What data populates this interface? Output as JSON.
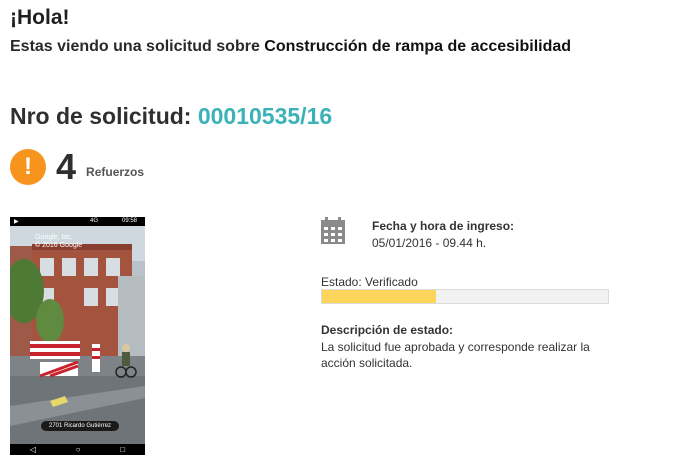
{
  "greeting": "¡Hola!",
  "intro": {
    "prefix": "Estas viendo una solicitud sobre",
    "subject": "Construcción de rampa de accesibilidad"
  },
  "request": {
    "label": "Nro de solicitud:",
    "number": "00010535/16"
  },
  "support": {
    "icon": "exclamation-icon",
    "count": "4",
    "label": "Refuerzos"
  },
  "photo": {
    "status_time": "09:58",
    "status_signal": "4G",
    "watermark_line1": "Google, Inc.",
    "watermark_line2": "© 2016 Google",
    "address": "2701 Ricardo Gutiérrez"
  },
  "details": {
    "date_label": "Fecha y hora de ingreso:",
    "date_value": "05/01/2016 - 09.44 h.",
    "state_label": "Estado:",
    "state_value": "Verificado",
    "progress": 0.4,
    "desc_label": "Descripción de estado:",
    "desc_text": "La solicitud fue aprobada y corresponde realizar la acción solicitada."
  },
  "colors": {
    "accent": "#3bb2b8",
    "alert": "#f7941d",
    "progress_fill": "#fcd55a"
  }
}
